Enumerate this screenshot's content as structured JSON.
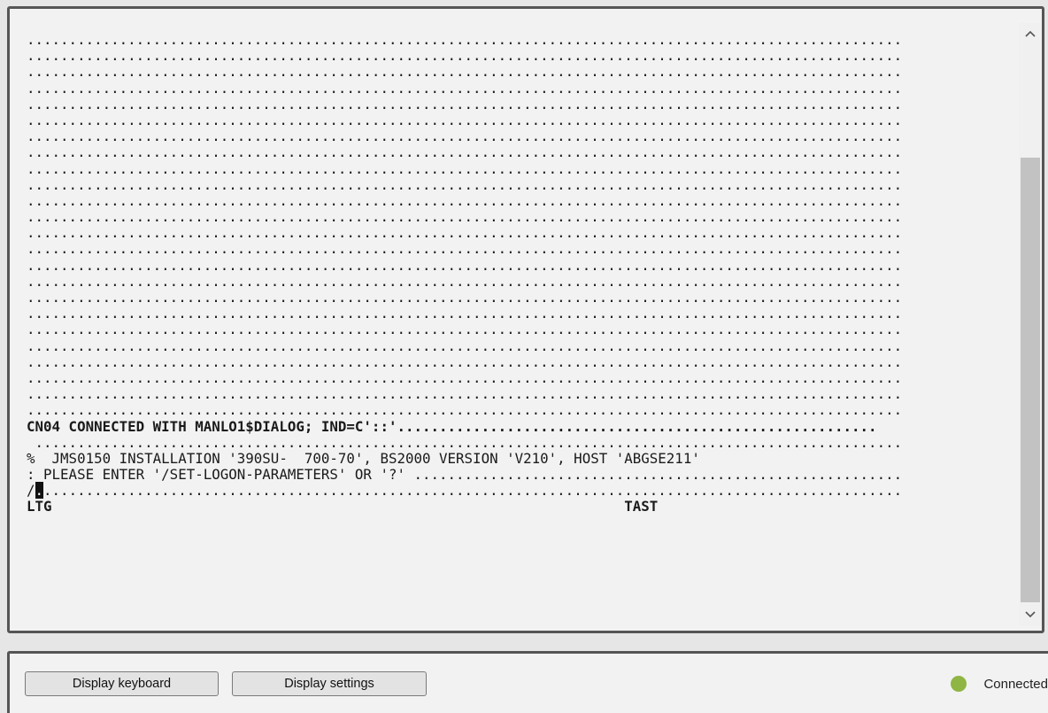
{
  "terminal": {
    "lines": [
      {
        "text": "........................................................................................................",
        "bold": false
      },
      {
        "text": "........................................................................................................",
        "bold": false
      },
      {
        "text": "........................................................................................................",
        "bold": false
      },
      {
        "text": "........................................................................................................",
        "bold": false
      },
      {
        "text": "........................................................................................................",
        "bold": false
      },
      {
        "text": "........................................................................................................",
        "bold": false
      },
      {
        "text": "........................................................................................................",
        "bold": false
      },
      {
        "text": "........................................................................................................",
        "bold": false
      },
      {
        "text": "........................................................................................................",
        "bold": false
      },
      {
        "text": "........................................................................................................",
        "bold": false
      },
      {
        "text": "........................................................................................................",
        "bold": false
      },
      {
        "text": "........................................................................................................",
        "bold": false
      },
      {
        "text": "........................................................................................................",
        "bold": false
      },
      {
        "text": "........................................................................................................",
        "bold": false
      },
      {
        "text": "........................................................................................................",
        "bold": false
      },
      {
        "text": "........................................................................................................",
        "bold": false
      },
      {
        "text": "........................................................................................................",
        "bold": false
      },
      {
        "text": "........................................................................................................",
        "bold": false
      },
      {
        "text": "........................................................................................................",
        "bold": false
      },
      {
        "text": "........................................................................................................",
        "bold": false
      },
      {
        "text": "........................................................................................................",
        "bold": false
      },
      {
        "text": "........................................................................................................",
        "bold": false
      },
      {
        "text": "........................................................................................................",
        "bold": false
      },
      {
        "text": "........................................................................................................",
        "bold": false
      },
      {
        "text": "CN04 CONNECTED WITH MANLO1$DIALOG; IND=C'::'.........................................................",
        "bold": true
      },
      {
        "text": " .......................................................................................................",
        "bold": false
      },
      {
        "text": "%  JMS0150 INSTALLATION '390SU-  700-70', BS2000 VERSION 'V210', HOST 'ABGSE211'",
        "bold": false
      },
      {
        "text": ": PLEASE ENTER '/SET-LOGON-PARAMETERS' OR '?' ..........................................................",
        "bold": false
      }
    ],
    "prompt": "/",
    "cursor_char": ".",
    "prompt_fill": "......................................................................................................",
    "status_left": "LTG",
    "status_right": "TAST",
    "status_gap": "                                                                    "
  },
  "scrollbar": {
    "up_icon": "chevron-up-icon",
    "down_icon": "chevron-down-icon",
    "up_glyph": "^",
    "down_glyph": "v"
  },
  "bottom_bar": {
    "keyboard_button": "Display keyboard",
    "settings_button": "Display settings",
    "status_text": "Connected",
    "status_color": "#8fb544"
  }
}
